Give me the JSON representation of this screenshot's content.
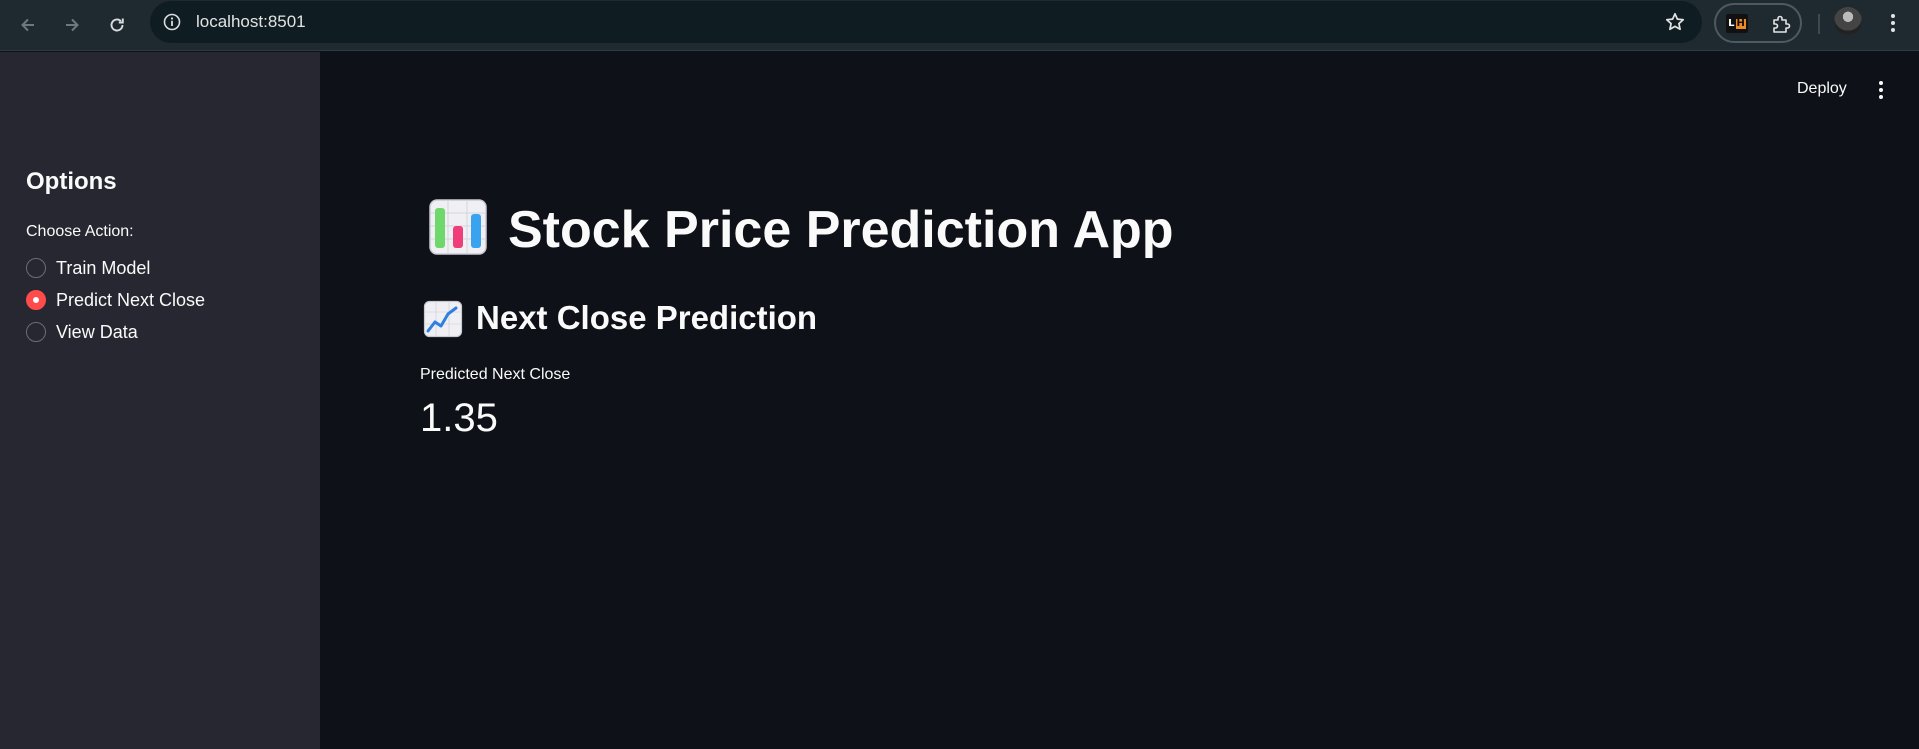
{
  "browser": {
    "url": "localhost:8501"
  },
  "sidebar": {
    "title": "Options",
    "radio_label": "Choose Action:",
    "options": [
      {
        "label": "Train Model",
        "selected": false
      },
      {
        "label": "Predict Next Close",
        "selected": true
      },
      {
        "label": "View Data",
        "selected": false
      }
    ]
  },
  "header": {
    "deploy_label": "Deploy"
  },
  "main": {
    "title": "Stock Price Prediction App",
    "subheader": "Next Close Prediction",
    "metric": {
      "label": "Predicted Next Close",
      "value": "1.35"
    }
  },
  "colors": {
    "accent": "#ff4b4b",
    "sidebar_bg": "#262730",
    "main_bg": "#0e1117",
    "chrome_bg": "#1f2a30"
  },
  "icons": {
    "title_icon": "bar-chart-emoji",
    "subheader_icon": "chart-increasing-emoji"
  }
}
